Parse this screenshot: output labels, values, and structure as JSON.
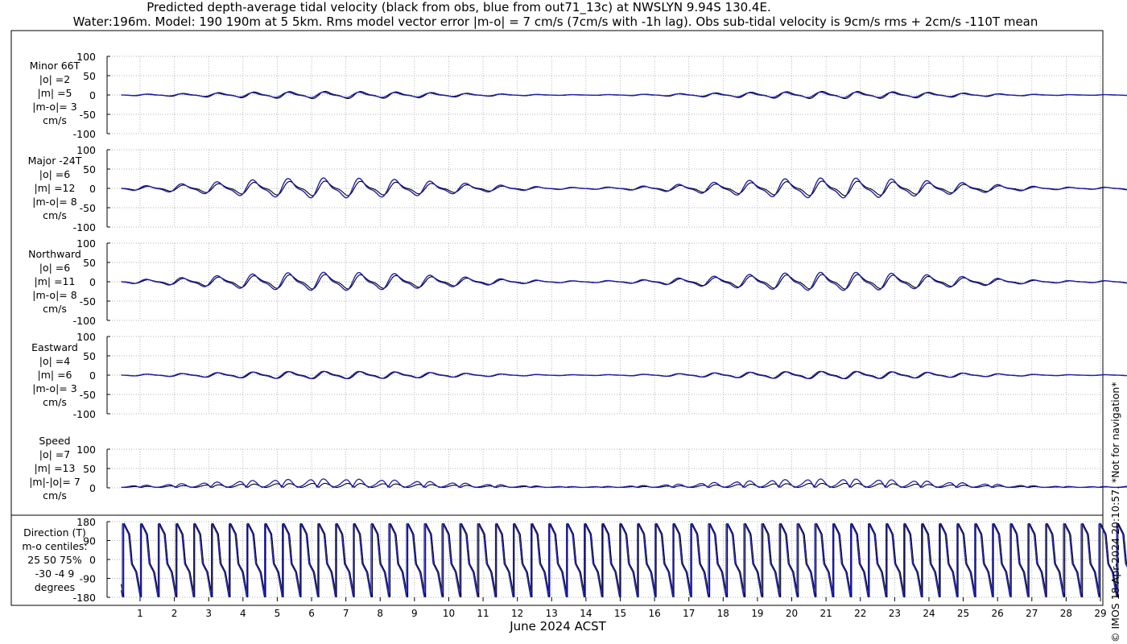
{
  "title_line1": "Predicted depth-average tidal velocity (black from obs, blue from out71_13c) at NWSLYN 9.94S 130.4E.",
  "title_line2": "Water:196m. Model: 190 190m at 5 5km. Rms model vector error |m-o| = 7 cm/s (7cm/s with -1h lag). Obs sub-tidal velocity is 9cm/s rms + 2cm/s -110T mean",
  "copyright": "© IMOS 18-Apr-2024 20:10:57. *Not for navigation*",
  "xlabel": "June 2024 ACST",
  "colors": {
    "obs": "#000000",
    "model": "#1f1fb0",
    "grid": "#9a9a9a"
  },
  "panels": [
    {
      "id": "minor",
      "lines": [
        "Minor 66T",
        "|o| =2",
        "|m| =5",
        "|m-o|= 3",
        "cm/s"
      ]
    },
    {
      "id": "major",
      "lines": [
        "Major -24T",
        "|o| =6",
        "|m| =12",
        "|m-o|= 8",
        "cm/s"
      ]
    },
    {
      "id": "north",
      "lines": [
        "Northward",
        "|o| =6",
        "|m| =11",
        "|m-o|= 8",
        "cm/s"
      ]
    },
    {
      "id": "east",
      "lines": [
        "Eastward",
        "|o| =4",
        "|m| =6",
        "|m-o|= 3",
        "cm/s"
      ]
    },
    {
      "id": "speed",
      "lines": [
        "Speed",
        "|o| =7",
        "|m| =13",
        "|m|-|o|= 7",
        "cm/s"
      ]
    },
    {
      "id": "direction",
      "lines": [
        "Direction (T)",
        "m-o centiles:",
        "25  50  75%",
        "-30  -4   9",
        "degrees"
      ]
    }
  ],
  "chart_data": {
    "type": "line",
    "x_axis": {
      "label": "June 2024 ACST",
      "ticks": [
        "1",
        "2",
        "3",
        "4",
        "5",
        "6",
        "7",
        "8",
        "9",
        "10",
        "11",
        "12",
        "13",
        "14",
        "15",
        "16",
        "17",
        "18",
        "19",
        "20",
        "21",
        "22",
        "23",
        "24",
        "25",
        "26",
        "27",
        "28",
        "29"
      ]
    },
    "subplots": [
      {
        "name": "Minor 66T",
        "units": "cm/s",
        "ylim": [
          -100,
          100
        ],
        "yticks": [
          "100",
          "50",
          "0",
          "-50",
          "-100"
        ],
        "obs_amp": 8,
        "model_amp": 6
      },
      {
        "name": "Major -24T",
        "units": "cm/s",
        "ylim": [
          -100,
          100
        ],
        "yticks": [
          "100",
          "50",
          "0",
          "-50",
          "-100"
        ],
        "obs_amp": 16,
        "model_amp": 22
      },
      {
        "name": "Northward",
        "units": "cm/s",
        "ylim": [
          -100,
          100
        ],
        "yticks": [
          "100",
          "50",
          "0",
          "-50",
          "-100"
        ],
        "obs_amp": 16,
        "model_amp": 20
      },
      {
        "name": "Eastward",
        "units": "cm/s",
        "ylim": [
          -100,
          100
        ],
        "yticks": [
          "100",
          "50",
          "0",
          "-50",
          "-100"
        ],
        "obs_amp": 8,
        "model_amp": 8
      },
      {
        "name": "Speed",
        "units": "cm/s",
        "ylim": [
          0,
          100
        ],
        "yticks": [
          "100",
          "50",
          "0"
        ],
        "obs_amp": 10,
        "model_amp": 20
      },
      {
        "name": "Direction (T)",
        "units": "degrees",
        "ylim": [
          -180,
          180
        ],
        "yticks": [
          "180",
          "90",
          "0",
          "-90",
          "-180"
        ]
      }
    ],
    "series": [
      {
        "name": "obs"
      },
      {
        "name": "model"
      }
    ],
    "grid": true
  }
}
